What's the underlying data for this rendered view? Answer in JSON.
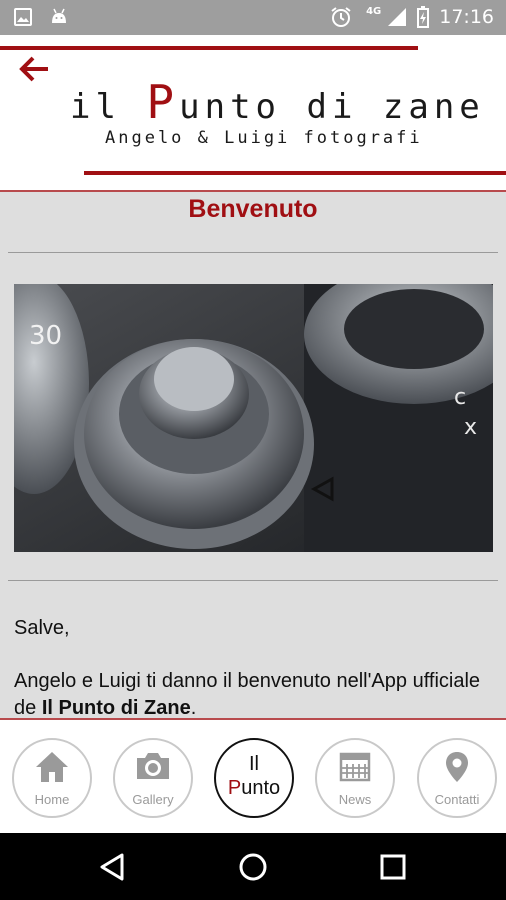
{
  "status_bar": {
    "time": "17:16",
    "network": "4G",
    "icons": [
      "image-icon",
      "android-icon",
      "alarm-icon",
      "signal-icon",
      "battery-charging-icon"
    ]
  },
  "header": {
    "title_pre": "il ",
    "title_p": "P",
    "title_rest": "unto di zane",
    "subtitle": "Angelo & Luigi fotografi"
  },
  "main": {
    "heading": "Benvenuto",
    "greeting": "Salve,",
    "intro_text": "Angelo e Luigi ti danno il benvenuto nell'App ufficiale de ",
    "intro_bold": "Il Punto di Zane",
    "intro_end": "."
  },
  "bottom_nav": {
    "items": [
      {
        "label": "Home",
        "icon": "home-icon"
      },
      {
        "label": "Gallery",
        "icon": "camera-icon"
      },
      {
        "label_line1": "Il",
        "label_p": "P",
        "label_rest": "unto",
        "active": true
      },
      {
        "label": "News",
        "icon": "calendar-icon"
      },
      {
        "label": "Contatti",
        "icon": "location-pin-icon"
      }
    ]
  },
  "colors": {
    "accent": "#a00f13",
    "status_bar": "#9e9e9e",
    "content_bg": "#dedede",
    "nav_icon": "#9a9a9a"
  }
}
